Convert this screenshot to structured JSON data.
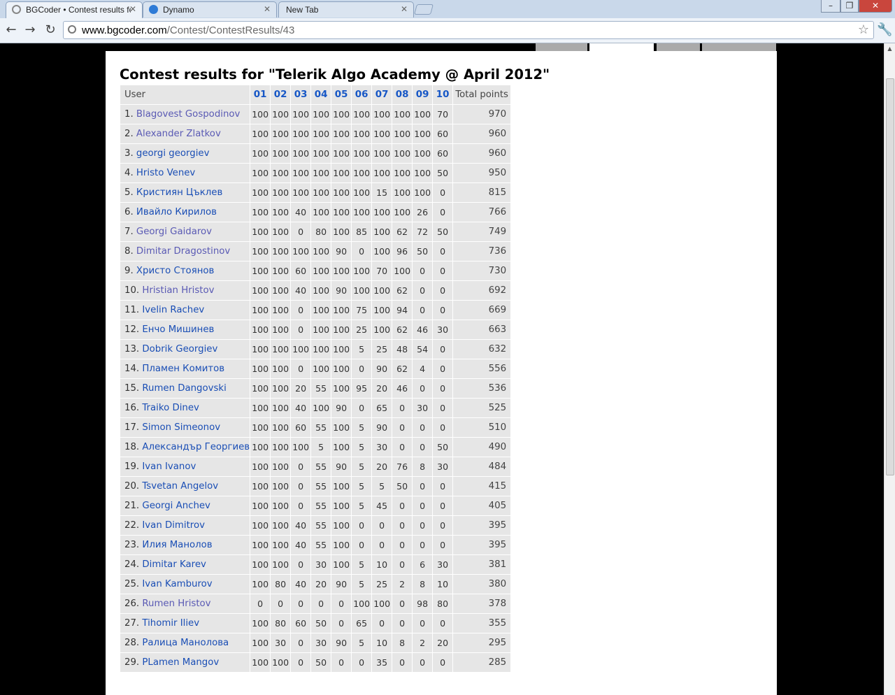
{
  "browser": {
    "tabs": [
      {
        "title": "BGCoder • Contest results fo",
        "active": true
      },
      {
        "title": "Dynamo",
        "active": false
      },
      {
        "title": "New Tab",
        "active": false
      }
    ],
    "url_host": "www.bgcoder.com",
    "url_path": "/Contest/ContestResults/43"
  },
  "page": {
    "heading": "Contest results for \"Telerik Algo Academy @ April 2012\"",
    "columns": {
      "user": "User",
      "tasks": [
        "01",
        "02",
        "03",
        "04",
        "05",
        "06",
        "07",
        "08",
        "09",
        "10"
      ],
      "total": "Total points"
    },
    "rows": [
      {
        "rank": "1.",
        "name": "Blagovest Gospodinov",
        "visited": true,
        "scores": [
          "100",
          "100",
          "100",
          "100",
          "100",
          "100",
          "100",
          "100",
          "100",
          "70"
        ],
        "total": "970"
      },
      {
        "rank": "2.",
        "name": "Alexander Zlatkov",
        "visited": true,
        "scores": [
          "100",
          "100",
          "100",
          "100",
          "100",
          "100",
          "100",
          "100",
          "100",
          "60"
        ],
        "total": "960"
      },
      {
        "rank": "3.",
        "name": "georgi georgiev",
        "visited": false,
        "scores": [
          "100",
          "100",
          "100",
          "100",
          "100",
          "100",
          "100",
          "100",
          "100",
          "60"
        ],
        "total": "960"
      },
      {
        "rank": "4.",
        "name": "Hristo Venev",
        "visited": false,
        "scores": [
          "100",
          "100",
          "100",
          "100",
          "100",
          "100",
          "100",
          "100",
          "100",
          "50"
        ],
        "total": "950"
      },
      {
        "rank": "5.",
        "name": "Кристиян Цъклев",
        "visited": false,
        "scores": [
          "100",
          "100",
          "100",
          "100",
          "100",
          "100",
          "15",
          "100",
          "100",
          "0"
        ],
        "total": "815"
      },
      {
        "rank": "6.",
        "name": "Ивайло Кирилов",
        "visited": false,
        "scores": [
          "100",
          "100",
          "40",
          "100",
          "100",
          "100",
          "100",
          "100",
          "26",
          "0"
        ],
        "total": "766"
      },
      {
        "rank": "7.",
        "name": "Georgi Gaidarov",
        "visited": true,
        "scores": [
          "100",
          "100",
          "0",
          "80",
          "100",
          "85",
          "100",
          "62",
          "72",
          "50"
        ],
        "total": "749"
      },
      {
        "rank": "8.",
        "name": "Dimitar Dragostinov",
        "visited": true,
        "scores": [
          "100",
          "100",
          "100",
          "100",
          "90",
          "0",
          "100",
          "96",
          "50",
          "0"
        ],
        "total": "736"
      },
      {
        "rank": "9.",
        "name": "Христо Стоянов",
        "visited": false,
        "scores": [
          "100",
          "100",
          "60",
          "100",
          "100",
          "100",
          "70",
          "100",
          "0",
          "0"
        ],
        "total": "730"
      },
      {
        "rank": "10.",
        "name": "Hristian Hristov",
        "visited": true,
        "scores": [
          "100",
          "100",
          "40",
          "100",
          "90",
          "100",
          "100",
          "62",
          "0",
          "0"
        ],
        "total": "692"
      },
      {
        "rank": "11.",
        "name": "Ivelin Rachev",
        "visited": false,
        "scores": [
          "100",
          "100",
          "0",
          "100",
          "100",
          "75",
          "100",
          "94",
          "0",
          "0"
        ],
        "total": "669"
      },
      {
        "rank": "12.",
        "name": "Енчо Мишинев",
        "visited": false,
        "scores": [
          "100",
          "100",
          "0",
          "100",
          "100",
          "25",
          "100",
          "62",
          "46",
          "30"
        ],
        "total": "663"
      },
      {
        "rank": "13.",
        "name": "Dobrik Georgiev",
        "visited": false,
        "scores": [
          "100",
          "100",
          "100",
          "100",
          "100",
          "5",
          "25",
          "48",
          "54",
          "0"
        ],
        "total": "632"
      },
      {
        "rank": "14.",
        "name": "Пламен Комитов",
        "visited": false,
        "scores": [
          "100",
          "100",
          "0",
          "100",
          "100",
          "0",
          "90",
          "62",
          "4",
          "0"
        ],
        "total": "556"
      },
      {
        "rank": "15.",
        "name": "Rumen Dangovski",
        "visited": false,
        "scores": [
          "100",
          "100",
          "20",
          "55",
          "100",
          "95",
          "20",
          "46",
          "0",
          "0"
        ],
        "total": "536"
      },
      {
        "rank": "16.",
        "name": "Traiko Dinev",
        "visited": false,
        "scores": [
          "100",
          "100",
          "40",
          "100",
          "90",
          "0",
          "65",
          "0",
          "30",
          "0"
        ],
        "total": "525"
      },
      {
        "rank": "17.",
        "name": "Simon Simeonov",
        "visited": false,
        "scores": [
          "100",
          "100",
          "60",
          "55",
          "100",
          "5",
          "90",
          "0",
          "0",
          "0"
        ],
        "total": "510"
      },
      {
        "rank": "18.",
        "name": "Александър Георгиев",
        "visited": false,
        "scores": [
          "100",
          "100",
          "100",
          "5",
          "100",
          "5",
          "30",
          "0",
          "0",
          "50"
        ],
        "total": "490"
      },
      {
        "rank": "19.",
        "name": "Ivan Ivanov",
        "visited": false,
        "scores": [
          "100",
          "100",
          "0",
          "55",
          "90",
          "5",
          "20",
          "76",
          "8",
          "30"
        ],
        "total": "484"
      },
      {
        "rank": "20.",
        "name": "Tsvetan Angelov",
        "visited": false,
        "scores": [
          "100",
          "100",
          "0",
          "55",
          "100",
          "5",
          "5",
          "50",
          "0",
          "0"
        ],
        "total": "415"
      },
      {
        "rank": "21.",
        "name": "Georgi Anchev",
        "visited": false,
        "scores": [
          "100",
          "100",
          "0",
          "55",
          "100",
          "5",
          "45",
          "0",
          "0",
          "0"
        ],
        "total": "405"
      },
      {
        "rank": "22.",
        "name": "Ivan Dimitrov",
        "visited": false,
        "scores": [
          "100",
          "100",
          "40",
          "55",
          "100",
          "0",
          "0",
          "0",
          "0",
          "0"
        ],
        "total": "395"
      },
      {
        "rank": "23.",
        "name": "Илия Манолов",
        "visited": false,
        "scores": [
          "100",
          "100",
          "40",
          "55",
          "100",
          "0",
          "0",
          "0",
          "0",
          "0"
        ],
        "total": "395"
      },
      {
        "rank": "24.",
        "name": "Dimitar Karev",
        "visited": false,
        "scores": [
          "100",
          "100",
          "0",
          "30",
          "100",
          "5",
          "10",
          "0",
          "6",
          "30"
        ],
        "total": "381"
      },
      {
        "rank": "25.",
        "name": "Ivan Kamburov",
        "visited": false,
        "scores": [
          "100",
          "80",
          "40",
          "20",
          "90",
          "5",
          "25",
          "2",
          "8",
          "10"
        ],
        "total": "380"
      },
      {
        "rank": "26.",
        "name": "Rumen Hristov",
        "visited": true,
        "scores": [
          "0",
          "0",
          "0",
          "0",
          "0",
          "100",
          "100",
          "0",
          "98",
          "80"
        ],
        "total": "378"
      },
      {
        "rank": "27.",
        "name": "Tihomir Iliev",
        "visited": false,
        "scores": [
          "100",
          "80",
          "60",
          "50",
          "0",
          "65",
          "0",
          "0",
          "0",
          "0"
        ],
        "total": "355"
      },
      {
        "rank": "28.",
        "name": "Ралица Манолова",
        "visited": false,
        "scores": [
          "100",
          "30",
          "0",
          "30",
          "90",
          "5",
          "10",
          "8",
          "2",
          "20"
        ],
        "total": "295"
      },
      {
        "rank": "29.",
        "name": "PLamen Mangov",
        "visited": false,
        "scores": [
          "100",
          "100",
          "0",
          "50",
          "0",
          "0",
          "35",
          "0",
          "0",
          "0"
        ],
        "total": "285"
      }
    ]
  }
}
